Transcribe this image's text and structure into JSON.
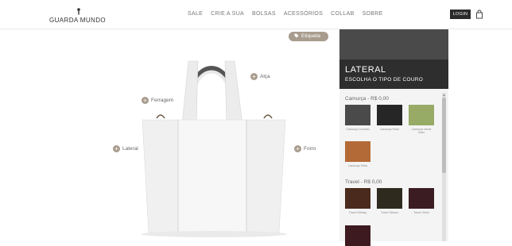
{
  "header": {
    "logo_text": "GUARDA MUNDO",
    "nav": [
      "SALE",
      "CRIE A SUA",
      "BOLSAS",
      "ACESSÓRIOS",
      "COLLAB",
      "SOBRE"
    ],
    "login_label": "LOGIN",
    "cart_icon": "shopping-bag-icon"
  },
  "canvas": {
    "etiqueta_label": "Etiqueta",
    "hotspots": {
      "alca": "Alça",
      "ferragem": "Ferragem",
      "lateral": "Lateral",
      "forro": "Forro"
    },
    "hotspot_symbol": "+",
    "bag_color": "#f5f5f5"
  },
  "panel": {
    "title": "LATERAL",
    "subtitle": "ESCOLHA O TIPO DE COURO",
    "sections": [
      {
        "label": "Camurça - R$ 0,00",
        "swatches": [
          {
            "name": "Camurça Chumbo",
            "color": "#4a4a4a"
          },
          {
            "name": "Camurça Preto",
            "color": "#262626"
          },
          {
            "name": "Camurça Verde Claro",
            "color": "#97ab66"
          },
          {
            "name": "Camurça Telha",
            "color": "#b46a36"
          }
        ]
      },
      {
        "label": "Travel - R$ 0,00",
        "swatches": [
          {
            "name": "Travel Whisky",
            "color": "#4a2a1c"
          },
          {
            "name": "Travel Tabaco",
            "color": "#2f2a1e"
          },
          {
            "name": "Travel Vinho",
            "color": "#3a1c22"
          },
          {
            "name": "",
            "color": "#3d1a20"
          }
        ]
      }
    ]
  },
  "colors": {
    "accent": "#a89c8e",
    "panel_dark": "#2e2e2e",
    "login_bg": "#2b2b2b"
  }
}
